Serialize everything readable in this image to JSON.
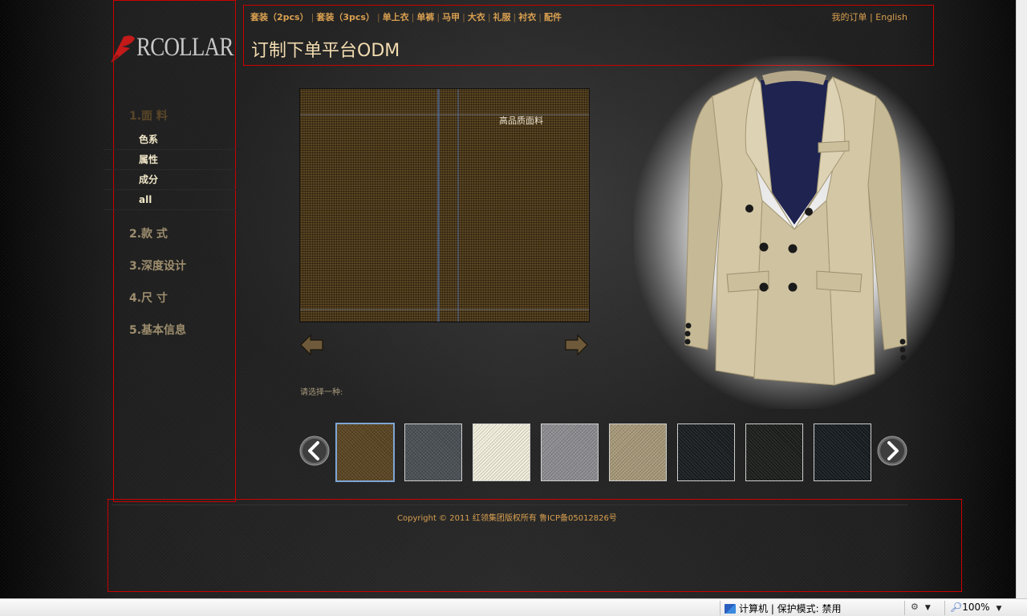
{
  "brand": {
    "logo_text": "RCOLLAR"
  },
  "header": {
    "categories": [
      "套装（2pcs）",
      "套装（3pcs）",
      "单上衣",
      "单裤",
      "马甲",
      "大衣",
      "礼服",
      "衬衣",
      "配件"
    ],
    "separator": "|",
    "my_orders": "我的订单",
    "english": "English",
    "title": "订制下单平台ODM"
  },
  "sidebar": {
    "steps": [
      {
        "label": "1.面 料",
        "active": true
      },
      {
        "label": "2.款 式",
        "active": false
      },
      {
        "label": "3.深度设计",
        "active": false
      },
      {
        "label": "4.尺 寸",
        "active": false
      },
      {
        "label": "5.基本信息",
        "active": false
      }
    ],
    "fabric_filters": [
      "色系",
      "属性",
      "成分",
      "all"
    ]
  },
  "preview": {
    "caption": "高品质面料",
    "prompt": "请选择一种:"
  },
  "swatches": [
    {
      "color": "#5a4522",
      "selected": true
    },
    {
      "color": "#4a5055",
      "selected": false
    },
    {
      "color": "#f2efdc",
      "selected": false
    },
    {
      "color": "#8e8e92",
      "selected": false
    },
    {
      "color": "#a89a7a",
      "selected": false
    },
    {
      "color": "#1a1d20",
      "selected": false
    },
    {
      "color": "#1c1e1c",
      "selected": false
    },
    {
      "color": "#161c1f",
      "selected": false
    }
  ],
  "footer": {
    "copyright": "Copyright © 2011 红领集团版权所有 鲁ICP备05012826号"
  },
  "statusbar": {
    "zone": "计算机 | 保护模式: 禁用",
    "zoom": "100%"
  },
  "colors": {
    "accent": "#d9a050",
    "frame_red": "#cc0000",
    "title": "#f2dcb0"
  }
}
